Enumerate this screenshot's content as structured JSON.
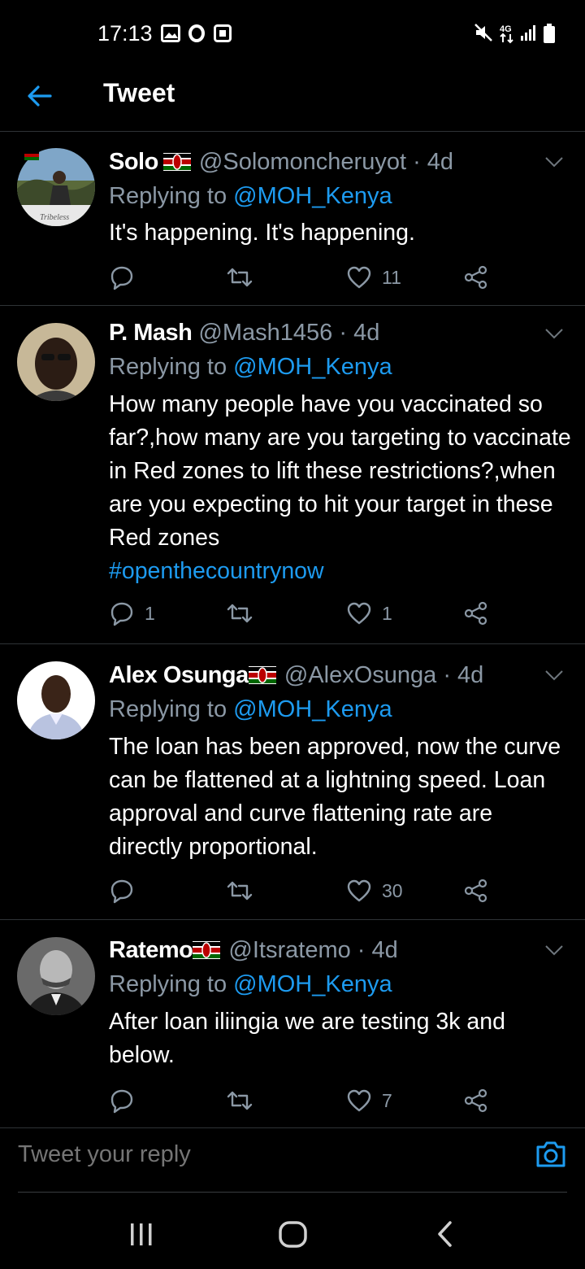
{
  "status_bar": {
    "time": "17:13",
    "left_icons": [
      "gallery-icon",
      "opera-icon",
      "screenshot-icon"
    ],
    "right_icons": [
      "mute-icon",
      "4g-icon",
      "signal-icon",
      "battery-icon"
    ],
    "network": "4G"
  },
  "app_bar": {
    "title": "Tweet",
    "back_icon": "back-arrow-icon"
  },
  "tweets": [
    {
      "name": "Solo",
      "has_flag": true,
      "handle": "@Solomoncheruyot",
      "age": "· 4d",
      "replying_prefix": "Replying to",
      "replying_to": "@MOH_Kenya",
      "text": "It's happening. It's happening.",
      "hashtag": "",
      "avatar_caption": "Tribeless",
      "replies": "",
      "retweets": "",
      "likes": "11"
    },
    {
      "name": "P. Mash",
      "has_flag": false,
      "handle": "@Mash1456",
      "age": "· 4d",
      "replying_prefix": "Replying to",
      "replying_to": "@MOH_Kenya",
      "text": "How many people have you vaccinated so far?,how many are you targeting to vaccinate in Red zones to lift these restrictions?,when are you expecting to hit your target in these Red zones",
      "hashtag": "#openthecountrynow",
      "replies": "1",
      "retweets": "",
      "likes": "1"
    },
    {
      "name": "Alex Osunga",
      "has_flag": true,
      "handle": "@AlexOsunga",
      "age": "· 4d",
      "replying_prefix": "Replying to",
      "replying_to": "@MOH_Kenya",
      "text": "The loan has been approved, now the curve can be flattened at a lightning speed. Loan approval and curve flattening rate are directly proportional.",
      "hashtag": "",
      "replies": "",
      "retweets": "",
      "likes": "30"
    },
    {
      "name": "Ratemo",
      "has_flag": true,
      "handle": "@Itsratemo",
      "age": "· 4d",
      "replying_prefix": "Replying to",
      "replying_to": "@MOH_Kenya",
      "text": "After loan iliingia we are testing 3k and below.",
      "hashtag": "",
      "replies": "",
      "retweets": "",
      "likes": "7"
    }
  ],
  "reply_box": {
    "placeholder": "Tweet your reply",
    "camera_icon": "camera-icon"
  },
  "nav_bar": {
    "icons": [
      "recent-apps-icon",
      "home-icon",
      "back-icon"
    ]
  },
  "colors": {
    "background": "#000000",
    "accent": "#1d9bf0",
    "muted_text": "#8b98a5",
    "divider": "#2f3336"
  }
}
